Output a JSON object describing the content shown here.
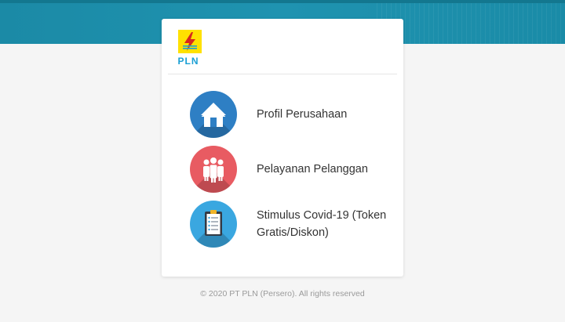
{
  "logo": {
    "text": "PLN",
    "box_color": "#ffe100",
    "text_color": "#1a9fd4",
    "bolt_color": "#d7261e"
  },
  "menu": {
    "items": [
      {
        "label": "Profil Perusahaan",
        "icon": "home-icon",
        "color": "#2e7fc4"
      },
      {
        "label": "Pelayanan Pelanggan",
        "icon": "people-icon",
        "color": "#e85b62"
      },
      {
        "label": "Stimulus Covid-19 (Token Gratis/Diskon)",
        "icon": "clipboard-icon",
        "color": "#3aa7e0"
      }
    ]
  },
  "footer": {
    "text": "© 2020 PT PLN (Persero). All rights reserved"
  },
  "colors": {
    "banner": "#1b8aa6",
    "background": "#f5f5f5"
  }
}
